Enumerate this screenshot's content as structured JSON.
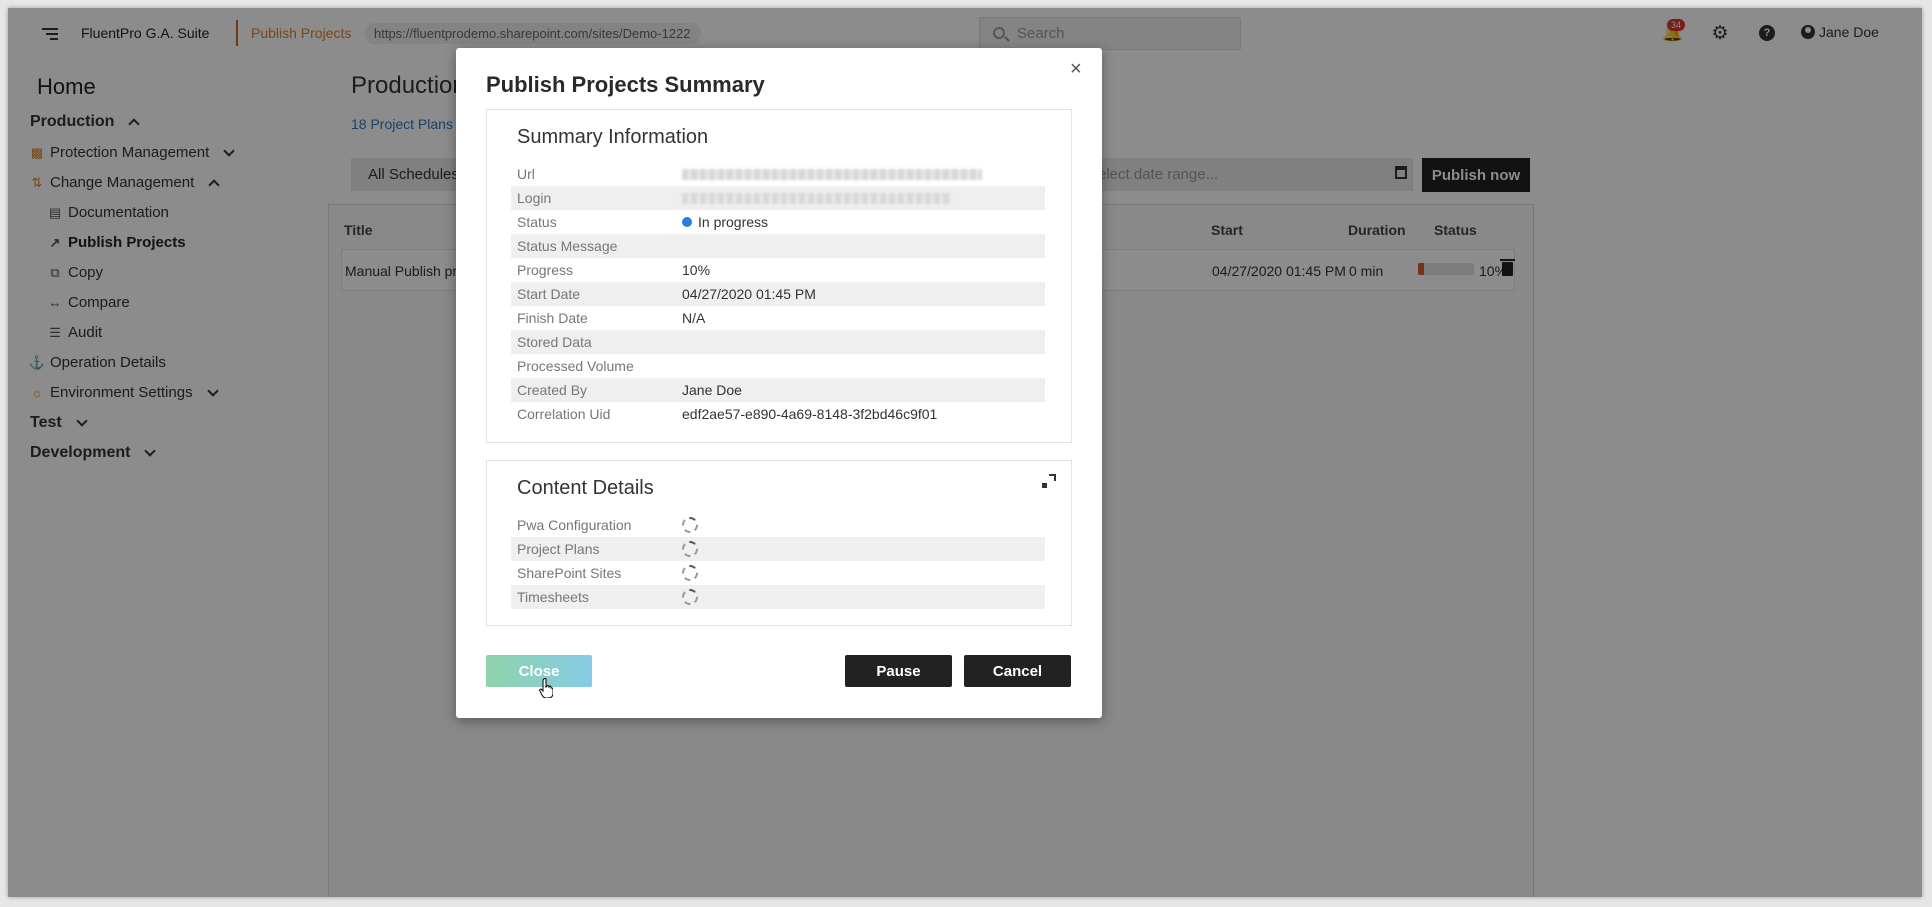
{
  "app": {
    "name": "FluentPro G.A. Suite",
    "breadcrumb": "Publish Projects",
    "url": "https://fluentprodemo.sharepoint.com/sites/Demo-1222",
    "search_placeholder": "Search",
    "notification_count": "34",
    "user_name": "Jane Doe",
    "accent_color": "#d9822b"
  },
  "sidebar": {
    "home": "Home",
    "groups": [
      {
        "label": "Production",
        "expanded": true
      },
      {
        "label": "Test",
        "expanded": false
      },
      {
        "label": "Development",
        "expanded": false
      }
    ],
    "items": [
      {
        "label": "Protection Management",
        "icon": "chart-icon"
      },
      {
        "label": "Change Management",
        "icon": "sliders-icon"
      },
      {
        "label": "Documentation",
        "icon": "document-icon"
      },
      {
        "label": "Publish Projects",
        "icon": "publish-icon",
        "active": true
      },
      {
        "label": "Copy",
        "icon": "copy-icon"
      },
      {
        "label": "Compare",
        "icon": "compare-icon"
      },
      {
        "label": "Audit",
        "icon": "audit-icon"
      },
      {
        "label": "Operation Details",
        "icon": "operation-icon"
      },
      {
        "label": "Environment Settings",
        "icon": "settings-icon"
      }
    ]
  },
  "page": {
    "title": "Production",
    "title_fade": "P",
    "project_count": "18 Project Plans",
    "filter_label": "All Schedules",
    "date_placeholder": "elect date range...",
    "publish_now": "Publish now",
    "columns": {
      "title": "Title",
      "start": "Start",
      "duration": "Duration",
      "status": "Status"
    },
    "row": {
      "title": "Manual Publish proje",
      "start": "04/27/2020 01:45 PM",
      "duration": "0 min",
      "progress": 10,
      "progress_label": "10%"
    }
  },
  "modal": {
    "title": "Publish Projects Summary",
    "close_glyph": "×",
    "summary": {
      "title": "Summary Information",
      "fields": [
        {
          "label": "Url",
          "value": ""
        },
        {
          "label": "Login",
          "value": ""
        },
        {
          "label": "Status",
          "value": "In progress"
        },
        {
          "label": "Status Message",
          "value": ""
        },
        {
          "label": "Progress",
          "value": "10%"
        },
        {
          "label": "Start Date",
          "value": "04/27/2020 01:45 PM"
        },
        {
          "label": "Finish Date",
          "value": "N/A"
        },
        {
          "label": "Stored Data",
          "value": ""
        },
        {
          "label": "Processed Volume",
          "value": ""
        },
        {
          "label": "Created By",
          "value": "Jane Doe"
        },
        {
          "label": "Correlation Uid",
          "value": "edf2ae57-e890-4a69-8148-3f2bd46c9f01"
        }
      ]
    },
    "content": {
      "title": "Content Details",
      "fields": [
        {
          "label": "Pwa Configuration"
        },
        {
          "label": "Project Plans"
        },
        {
          "label": "SharePoint Sites"
        },
        {
          "label": "Timesheets"
        }
      ]
    },
    "buttons": {
      "close": "Close",
      "pause": "Pause",
      "cancel": "Cancel"
    },
    "status_color": "#2b7be0"
  }
}
